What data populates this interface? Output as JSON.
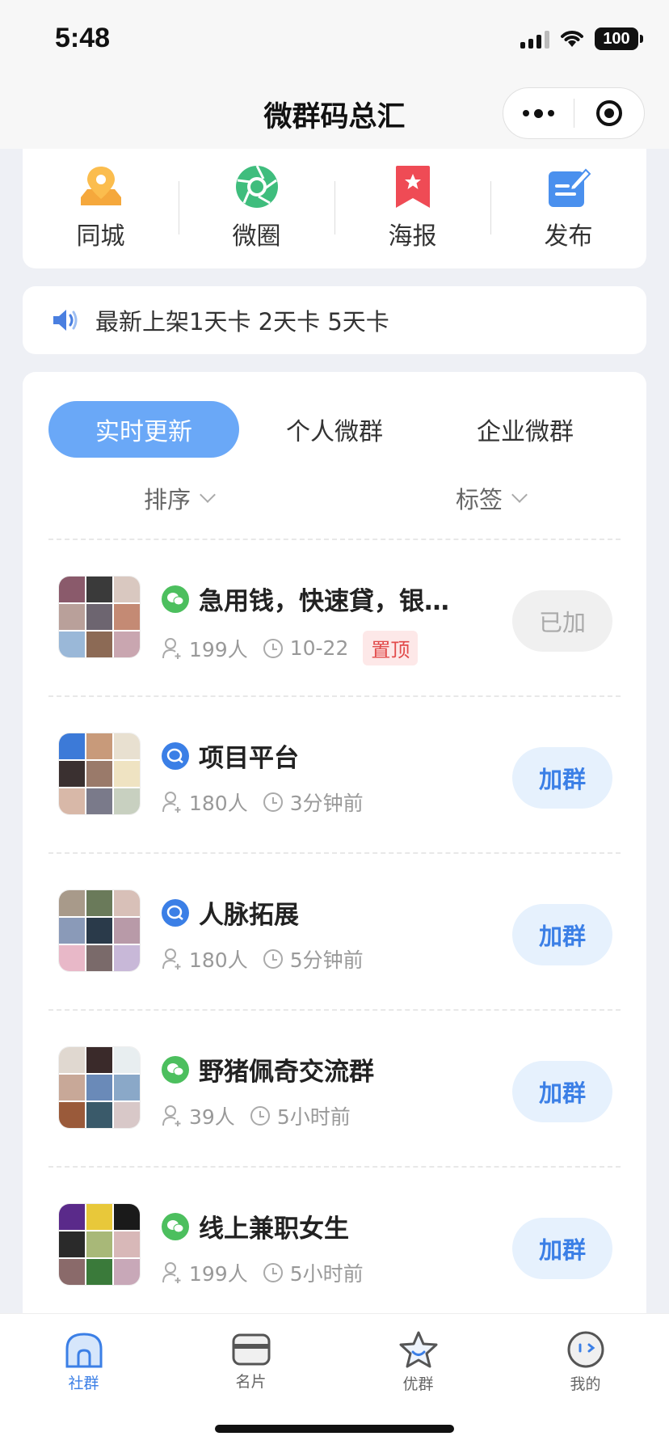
{
  "status_bar": {
    "time": "5:48",
    "battery": "100"
  },
  "nav": {
    "title": "微群码总汇"
  },
  "quick_entries": [
    {
      "label": "同城",
      "icon": "location-icon"
    },
    {
      "label": "微圈",
      "icon": "aperture-icon"
    },
    {
      "label": "海报",
      "icon": "poster-bookmark-icon"
    },
    {
      "label": "发布",
      "icon": "publish-edit-icon"
    }
  ],
  "notice": {
    "text": "最新上架1天卡 2天卡 5天卡"
  },
  "tabs": [
    {
      "label": "实时更新",
      "active": true
    },
    {
      "label": "个人微群",
      "active": false
    },
    {
      "label": "企业微群",
      "active": false
    }
  ],
  "filters": [
    {
      "label": "排序"
    },
    {
      "label": "标签"
    }
  ],
  "groups": [
    {
      "title": "急用钱，快速貸，银…",
      "type": "wechat",
      "members": "199人",
      "time": "10-22",
      "tag": "置顶",
      "button": "已加",
      "joined": true
    },
    {
      "title": "项目平台",
      "type": "enterprise",
      "members": "180人",
      "time": "3分钟前",
      "tag": "",
      "button": "加群",
      "joined": false
    },
    {
      "title": "人脉拓展",
      "type": "enterprise",
      "members": "180人",
      "time": "5分钟前",
      "tag": "",
      "button": "加群",
      "joined": false
    },
    {
      "title": "野猪佩奇交流群",
      "type": "wechat",
      "members": "39人",
      "time": "5小时前",
      "tag": "",
      "button": "加群",
      "joined": false
    },
    {
      "title": "线上兼职女生",
      "type": "wechat",
      "members": "199人",
      "time": "5小时前",
      "tag": "",
      "button": "加群",
      "joined": false
    }
  ],
  "tab_bar": [
    {
      "label": "社群",
      "active": true,
      "icon": "home-icon"
    },
    {
      "label": "名片",
      "active": false,
      "icon": "card-icon"
    },
    {
      "label": "优群",
      "active": false,
      "icon": "star-icon"
    },
    {
      "label": "我的",
      "active": false,
      "icon": "profile-face-icon"
    }
  ],
  "colors": {
    "accent": "#3b7fe6",
    "tab_active": "#6aa8f7",
    "wechat_green": "#4cbf5e",
    "top_tag": "#e24a4a"
  }
}
